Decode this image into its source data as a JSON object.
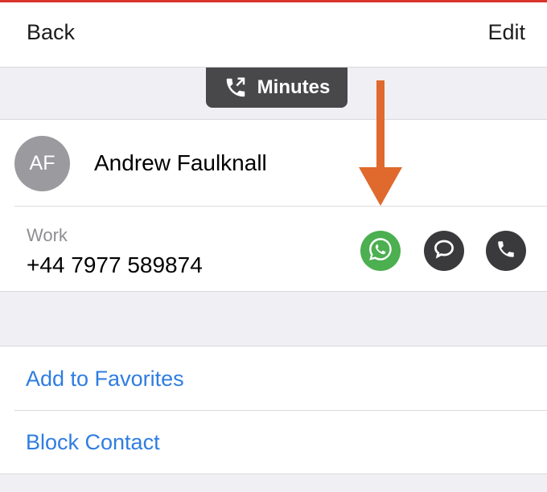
{
  "nav": {
    "back_label": "Back",
    "edit_label": "Edit"
  },
  "call_pill": {
    "label": "Minutes",
    "icon": "phone-transfer-icon"
  },
  "contact": {
    "initials": "AF",
    "name": "Andrew Faulknall",
    "phone_label": "Work",
    "phone_number": "+44 7977 589874"
  },
  "actions": {
    "whatsapp_icon": "whatsapp-icon",
    "message_icon": "message-bubble-icon",
    "call_icon": "phone-icon",
    "add_to_favorites": "Add to Favorites",
    "block_contact": "Block Contact"
  },
  "colors": {
    "accent_blue": "#2f7de1",
    "whatsapp_green": "#4caf50",
    "arrow_orange": "#e0692d",
    "top_bar_red": "#d9342b",
    "pill_bg": "#48484a"
  }
}
